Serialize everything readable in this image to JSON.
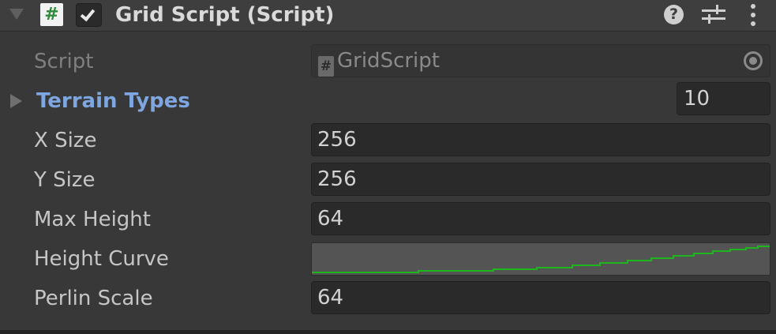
{
  "component": {
    "title": "Grid Script (Script)",
    "enabled": true,
    "icon": "csharp-script-icon"
  },
  "header_icons": [
    "help-icon",
    "presets-icon",
    "context-menu-icon"
  ],
  "fields": {
    "script": {
      "label": "Script",
      "value": "GridScript",
      "icon": "csharp-script-icon",
      "picker_icon": "object-picker-icon"
    },
    "terrain_types": {
      "label": "Terrain Types",
      "size": "10"
    },
    "x_size": {
      "label": "X Size",
      "value": "256"
    },
    "y_size": {
      "label": "Y Size",
      "value": "256"
    },
    "max_height": {
      "label": "Max Height",
      "value": "64"
    },
    "height_curve": {
      "label": "Height Curve",
      "curve_color": "#1fb51f"
    },
    "perlin_scale": {
      "label": "Perlin Scale",
      "value": "64"
    }
  },
  "colors": {
    "background": "#383838",
    "header": "#3e3e3e",
    "link_label": "#7ea6e0",
    "curve": "#1fb51f"
  }
}
